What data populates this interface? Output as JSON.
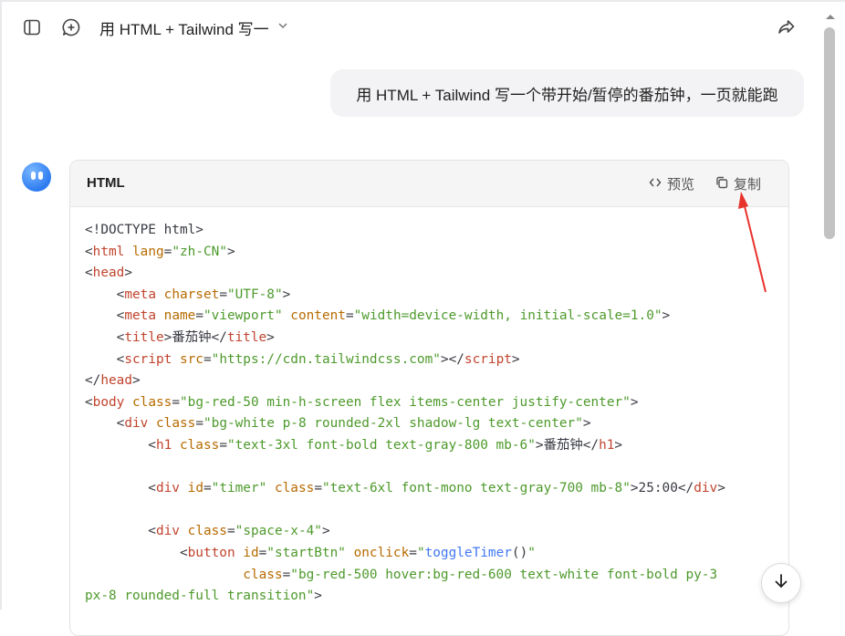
{
  "header": {
    "title": "用 HTML + Tailwind 写一",
    "icons": [
      "sidebar-toggle-icon",
      "new-chat-icon",
      "chevron-down-icon",
      "share-icon"
    ]
  },
  "message": {
    "user_text": "用 HTML + Tailwind 写一个带开始/暂停的番茄钟，一页就能跑"
  },
  "code_block": {
    "language": "HTML",
    "preview_label": "预览",
    "copy_label": "复制",
    "lines": [
      [
        [
          "p",
          "<!DOCTYPE html>"
        ]
      ],
      [
        [
          "p",
          "<"
        ],
        [
          "tag",
          "html"
        ],
        [
          "p",
          " "
        ],
        [
          "attr",
          "lang"
        ],
        [
          "p",
          "="
        ],
        [
          "str",
          "\"zh-CN\""
        ],
        [
          "p",
          ">"
        ]
      ],
      [
        [
          "p",
          "<"
        ],
        [
          "tag",
          "head"
        ],
        [
          "p",
          ">"
        ]
      ],
      [
        [
          "p",
          "    <"
        ],
        [
          "tag",
          "meta"
        ],
        [
          "p",
          " "
        ],
        [
          "attr",
          "charset"
        ],
        [
          "p",
          "="
        ],
        [
          "str",
          "\"UTF-8\""
        ],
        [
          "p",
          ">"
        ]
      ],
      [
        [
          "p",
          "    <"
        ],
        [
          "tag",
          "meta"
        ],
        [
          "p",
          " "
        ],
        [
          "attr",
          "name"
        ],
        [
          "p",
          "="
        ],
        [
          "str",
          "\"viewport\""
        ],
        [
          "p",
          " "
        ],
        [
          "attr",
          "content"
        ],
        [
          "p",
          "="
        ],
        [
          "str",
          "\"width=device-width, initial-scale=1.0\""
        ],
        [
          "p",
          ">"
        ]
      ],
      [
        [
          "p",
          "    <"
        ],
        [
          "tag",
          "title"
        ],
        [
          "p",
          ">"
        ],
        [
          "cn",
          "番茄钟"
        ],
        [
          "p",
          "</"
        ],
        [
          "tag",
          "title"
        ],
        [
          "p",
          ">"
        ]
      ],
      [
        [
          "p",
          "    <"
        ],
        [
          "tag",
          "script"
        ],
        [
          "p",
          " "
        ],
        [
          "attr",
          "src"
        ],
        [
          "p",
          "="
        ],
        [
          "str",
          "\"https://cdn.tailwindcss.com\""
        ],
        [
          "p",
          "></"
        ],
        [
          "tag",
          "script"
        ],
        [
          "p",
          ">"
        ]
      ],
      [
        [
          "p",
          "</"
        ],
        [
          "tag",
          "head"
        ],
        [
          "p",
          ">"
        ]
      ],
      [
        [
          "p",
          "<"
        ],
        [
          "tag",
          "body"
        ],
        [
          "p",
          " "
        ],
        [
          "attr",
          "class"
        ],
        [
          "p",
          "="
        ],
        [
          "str",
          "\"bg-red-50 min-h-screen flex items-center justify-center\""
        ],
        [
          "p",
          ">"
        ]
      ],
      [
        [
          "p",
          "    <"
        ],
        [
          "tag",
          "div"
        ],
        [
          "p",
          " "
        ],
        [
          "attr",
          "class"
        ],
        [
          "p",
          "="
        ],
        [
          "str",
          "\"bg-white p-8 rounded-2xl shadow-lg text-center\""
        ],
        [
          "p",
          ">"
        ]
      ],
      [
        [
          "p",
          "        <"
        ],
        [
          "tag",
          "h1"
        ],
        [
          "p",
          " "
        ],
        [
          "attr",
          "class"
        ],
        [
          "p",
          "="
        ],
        [
          "str",
          "\"text-3xl font-bold text-gray-800 mb-6\""
        ],
        [
          "p",
          ">"
        ],
        [
          "cn",
          "番茄钟"
        ],
        [
          "p",
          "</"
        ],
        [
          "tag",
          "h1"
        ],
        [
          "p",
          ">"
        ]
      ],
      [
        [
          "p",
          ""
        ]
      ],
      [
        [
          "p",
          "        <"
        ],
        [
          "tag",
          "div"
        ],
        [
          "p",
          " "
        ],
        [
          "attr",
          "id"
        ],
        [
          "p",
          "="
        ],
        [
          "str",
          "\"timer\""
        ],
        [
          "p",
          " "
        ],
        [
          "attr",
          "class"
        ],
        [
          "p",
          "="
        ],
        [
          "str",
          "\"text-6xl font-mono text-gray-700 mb-8\""
        ],
        [
          "p",
          ">25:00</"
        ],
        [
          "tag",
          "div"
        ],
        [
          "p",
          ">"
        ]
      ],
      [
        [
          "p",
          ""
        ]
      ],
      [
        [
          "p",
          "        <"
        ],
        [
          "tag",
          "div"
        ],
        [
          "p",
          " "
        ],
        [
          "attr",
          "class"
        ],
        [
          "p",
          "="
        ],
        [
          "str",
          "\"space-x-4\""
        ],
        [
          "p",
          ">"
        ]
      ],
      [
        [
          "p",
          "            <"
        ],
        [
          "tag",
          "button"
        ],
        [
          "p",
          " "
        ],
        [
          "attr",
          "id"
        ],
        [
          "p",
          "="
        ],
        [
          "str",
          "\"startBtn\""
        ],
        [
          "p",
          " "
        ],
        [
          "attr",
          "onclick"
        ],
        [
          "p",
          "="
        ],
        [
          "str",
          "\""
        ],
        [
          "fn",
          "toggleTimer"
        ],
        [
          "p",
          "()"
        ],
        [
          "str",
          "\""
        ]
      ],
      [
        [
          "p",
          "                    "
        ],
        [
          "attr",
          "class"
        ],
        [
          "p",
          "="
        ],
        [
          "str",
          "\"bg-red-500 hover:bg-red-600 text-white font-bold py-3"
        ]
      ],
      [
        [
          "str",
          "px-8 rounded-full transition\""
        ],
        [
          "p",
          ">"
        ]
      ]
    ]
  },
  "colors": {
    "accent_blue": "#2d7bf0",
    "annotation_red": "#e8332c",
    "tag": "#c1442e",
    "attr": "#b76b01",
    "string": "#4e9a2c"
  }
}
